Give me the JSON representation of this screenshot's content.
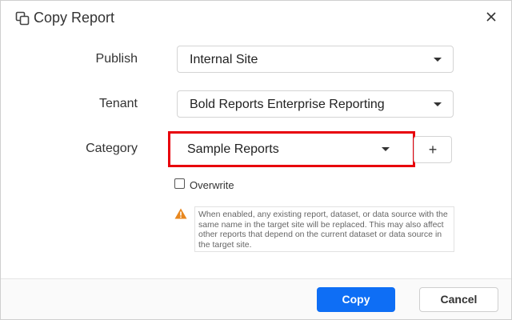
{
  "dialog": {
    "title": "Copy Report",
    "title_icon": "copy-icon",
    "close_icon": "close-icon"
  },
  "form": {
    "publish": {
      "label": "Publish",
      "value": "Internal Site"
    },
    "tenant": {
      "label": "Tenant",
      "value": "Bold Reports Enterprise Reporting"
    },
    "category": {
      "label": "Category",
      "value": "Sample Reports",
      "add_label": "+"
    },
    "overwrite": {
      "label": "Overwrite",
      "checked": false
    },
    "note": {
      "icon": "warning-icon",
      "text": "When enabled, any existing report, dataset, or data source with the same name in the target site will be replaced. This may also affect other reports that depend on the current dataset or data source in the target site."
    }
  },
  "footer": {
    "copy_label": "Copy",
    "cancel_label": "Cancel"
  },
  "colors": {
    "primary": "#0e6ef5",
    "highlight": "#e8000b",
    "warning": "#e8871e"
  }
}
